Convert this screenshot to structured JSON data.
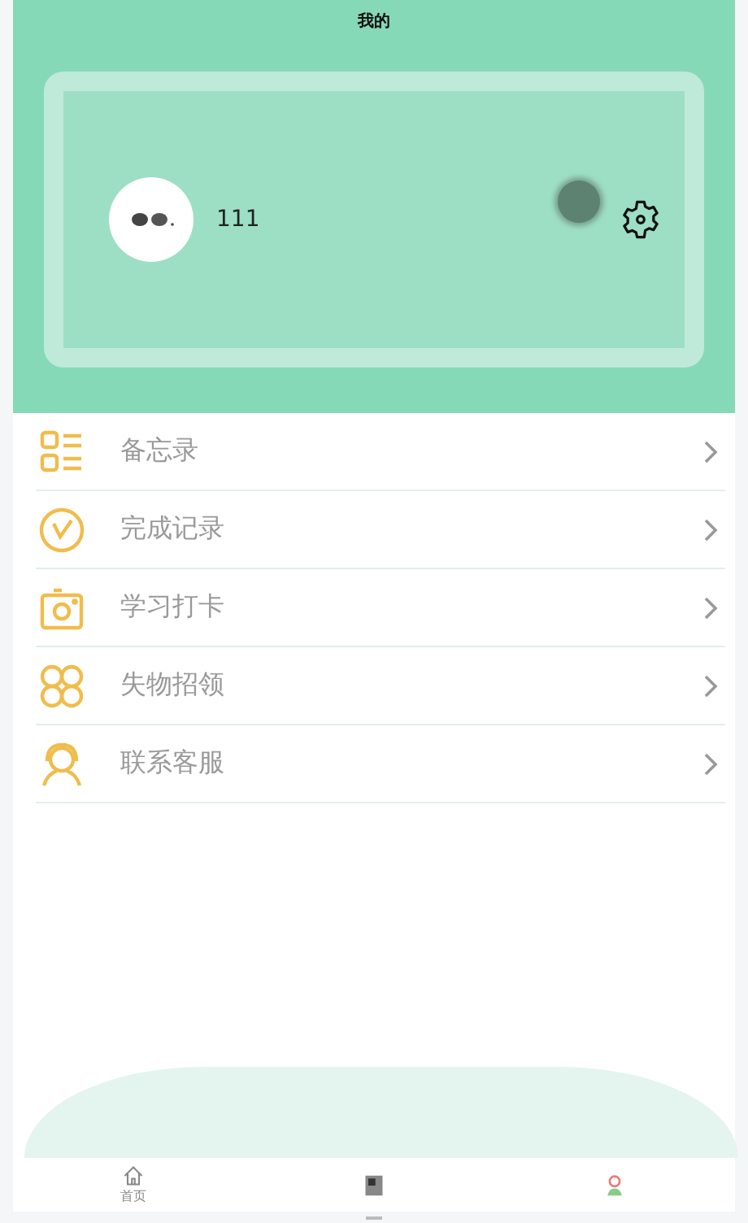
{
  "header": {
    "title": "我的"
  },
  "profile": {
    "name": "111"
  },
  "menu": [
    {
      "label": "备忘录"
    },
    {
      "label": "完成记录"
    },
    {
      "label": "学习打卡"
    },
    {
      "label": "失物招领"
    },
    {
      "label": "联系客服"
    }
  ],
  "tab_bar": {
    "labels": [
      "首页"
    ]
  }
}
